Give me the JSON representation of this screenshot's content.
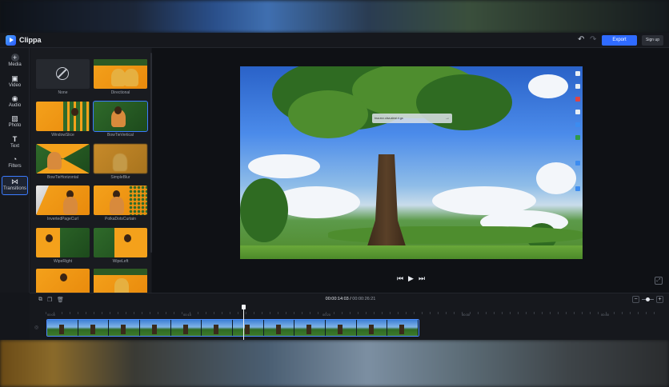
{
  "app": {
    "name": "Clippa"
  },
  "toolbar": {
    "undo_icon": "undo-icon",
    "redo_icon": "redo-icon",
    "export_label": "Export",
    "signup_label": "Sign up"
  },
  "sidebar": {
    "items": [
      {
        "label": "Media",
        "icon": "plus-circle-icon"
      },
      {
        "label": "Video",
        "icon": "video-icon"
      },
      {
        "label": "Audio",
        "icon": "music-icon"
      },
      {
        "label": "Photo",
        "icon": "image-icon"
      },
      {
        "label": "Text",
        "icon": "text-icon"
      },
      {
        "label": "Filters",
        "icon": "filters-icon"
      },
      {
        "label": "Transitions",
        "icon": "transitions-icon",
        "active": true
      }
    ]
  },
  "transitions": {
    "items": [
      {
        "label": "None"
      },
      {
        "label": "Directional"
      },
      {
        "label": "WindowSlice"
      },
      {
        "label": "BowTieVertical"
      },
      {
        "label": "BowTieHorizontal"
      },
      {
        "label": "SimpleBlur"
      },
      {
        "label": "InvertedPageCurl"
      },
      {
        "label": "PolkaDotsCurtain"
      },
      {
        "label": "WipeRight"
      },
      {
        "label": "WipeLeft"
      }
    ]
  },
  "preview": {
    "url_text": "bsa.ecx.ulsa.aieai.rl.ga"
  },
  "player": {
    "prev_icon": "skip-back-icon",
    "play_icon": "play-icon",
    "next_icon": "skip-forward-icon",
    "fit_icon": "fit-screen-icon"
  },
  "timeline": {
    "current_time": "00:00:14:03",
    "separator": "/",
    "total_time": "00:00:26:21",
    "ruler_labels": [
      "00:00",
      "00:10",
      "00:20",
      "00:30",
      "00:40"
    ],
    "zoom_minus": "−",
    "zoom_plus": "+"
  },
  "colors": {
    "accent": "#2f6bff",
    "active_outline": "#3b7bff"
  }
}
